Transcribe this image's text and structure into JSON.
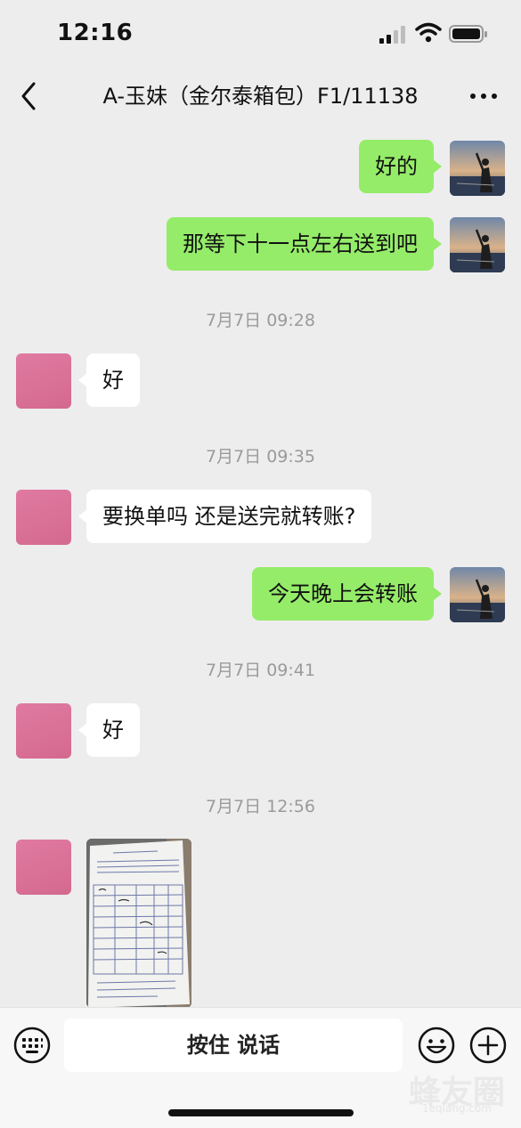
{
  "status_bar": {
    "time": "12:16"
  },
  "nav": {
    "title": "A-玉妹（金尔泰箱包）F1/11138"
  },
  "messages": [
    {
      "side": "right",
      "text": "好的"
    },
    {
      "side": "right",
      "text": "那等下十一点左右送到吧"
    },
    {
      "type": "timestamp",
      "text": "7月7日 09:28"
    },
    {
      "side": "left",
      "text": "好"
    },
    {
      "type": "timestamp",
      "text": "7月7日 09:35"
    },
    {
      "side": "left",
      "text": "要换单吗 还是送完就转账?"
    },
    {
      "side": "right",
      "text": "今天晚上会转账"
    },
    {
      "type": "timestamp",
      "text": "7月7日 09:41"
    },
    {
      "side": "left",
      "text": "好"
    },
    {
      "type": "timestamp",
      "text": "7月7日 12:56"
    },
    {
      "side": "left",
      "type": "image",
      "icon": "receipt-photo"
    }
  ],
  "input_bar": {
    "voice_label": "按住 说话"
  },
  "watermark": {
    "text": "蜂友圈",
    "sub": "1eqiang.com"
  },
  "colors": {
    "background": "#ededed",
    "bubble_green": "#95ec69",
    "bubble_white": "#ffffff",
    "avatar_pink": "#dc7199"
  }
}
